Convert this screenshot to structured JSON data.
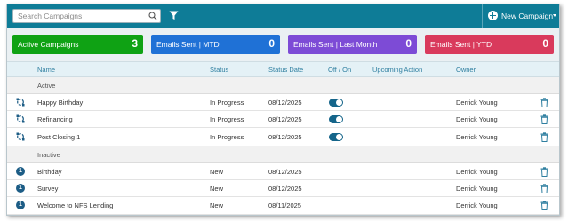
{
  "search": {
    "placeholder": "Search Campaigns"
  },
  "toolbar": {
    "new_campaign_label": "New Campaign"
  },
  "cards": [
    {
      "label": "Active Campaigns",
      "value": "3",
      "color": "#0fa214"
    },
    {
      "label": "Emails Sent | MTD",
      "value": "0",
      "color": "#1f71d6"
    },
    {
      "label": "Emails Sent | Last Month",
      "value": "0",
      "color": "#7d4bd6"
    },
    {
      "label": "Emails Sent | YTD",
      "value": "0",
      "color": "#d93a5c"
    }
  ],
  "table": {
    "headers": {
      "name": "Name",
      "status": "Status",
      "status_date": "Status Date",
      "toggle": "Off / On",
      "upcoming": "Upcoming Action",
      "owner": "Owner"
    },
    "groups": [
      {
        "label": "Active",
        "rows": [
          {
            "name": "Happy Birthday",
            "status": "In Progress",
            "date": "08/12/2025",
            "on": true,
            "owner": "Derrick Young"
          },
          {
            "name": "Refinancing",
            "status": "In Progress",
            "date": "08/12/2025",
            "on": true,
            "owner": "Derrick Young"
          },
          {
            "name": "Post Closing 1",
            "status": "In Progress",
            "date": "08/12/2025",
            "on": true,
            "owner": "Derrick Young"
          }
        ]
      },
      {
        "label": "Inactive",
        "rows": [
          {
            "name": "Birthday",
            "status": "New",
            "date": "08/12/2025",
            "badge": "1",
            "owner": "Derrick Young"
          },
          {
            "name": "Survey",
            "status": "New",
            "date": "08/12/2025",
            "badge": "1",
            "owner": "Derrick Young"
          },
          {
            "name": "Welcome to NFS Lending",
            "status": "New",
            "date": "08/11/2025",
            "badge": "1",
            "owner": "Derrick Young"
          }
        ]
      }
    ]
  },
  "colors": {
    "topbar": "#0e7c97",
    "header_text": "#2f7fa0",
    "toggle_on": "#15658a",
    "badge": "#1d5d86"
  }
}
